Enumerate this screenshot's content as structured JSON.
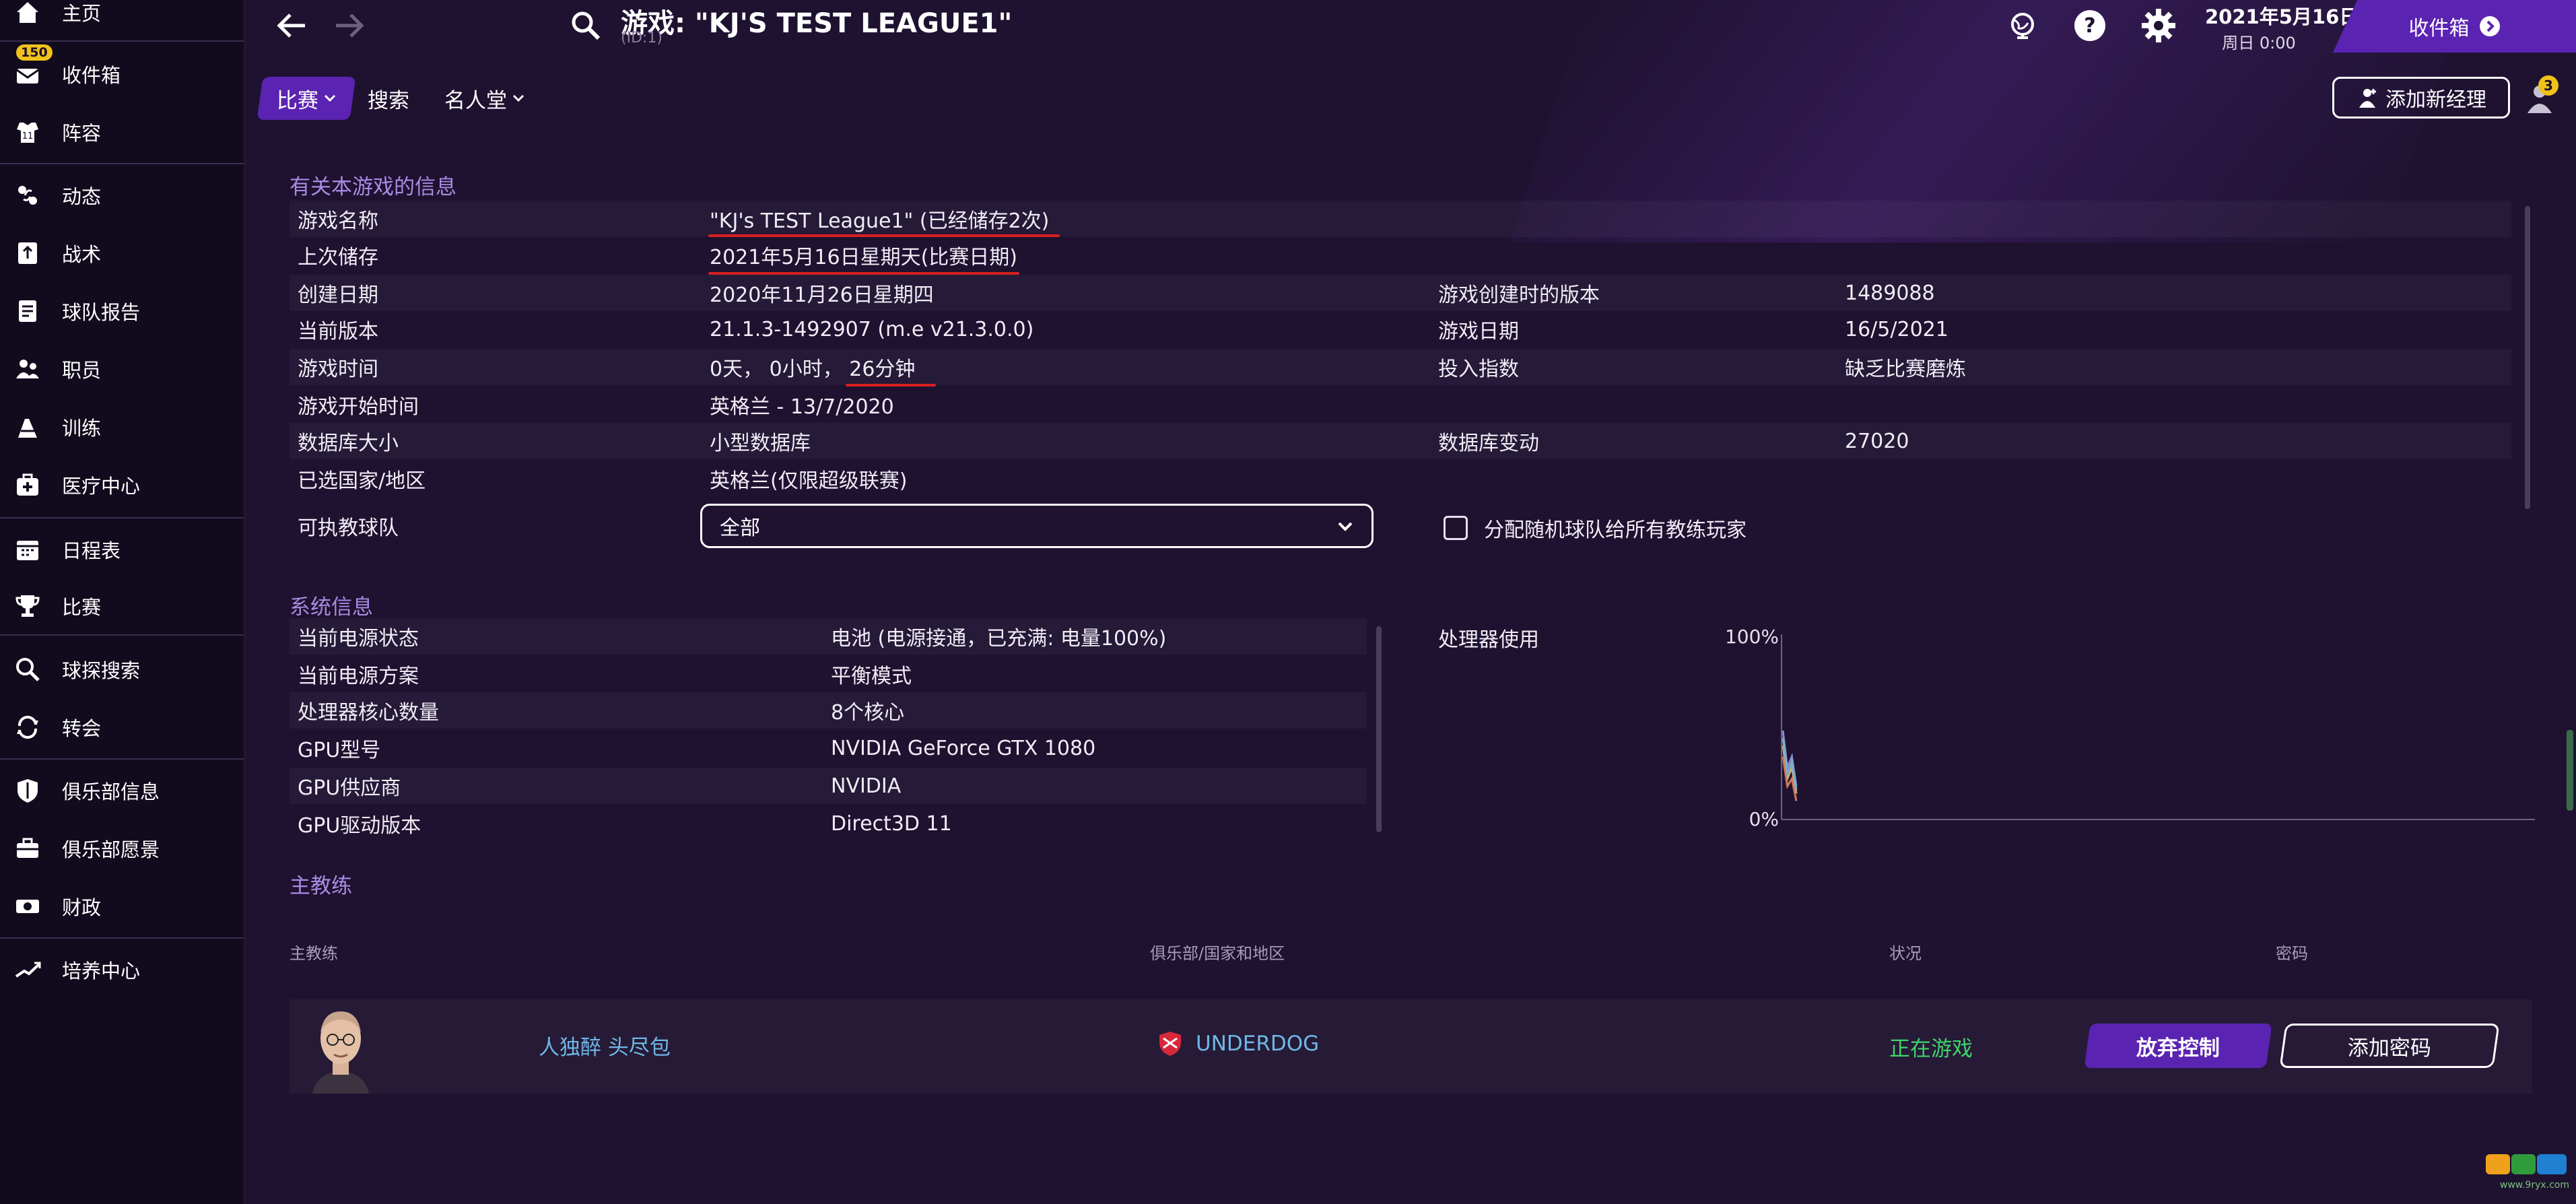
{
  "sidebar": {
    "items": [
      {
        "label": "主页",
        "icon": "home-icon"
      },
      {
        "label": "收件箱",
        "icon": "inbox-icon",
        "badge": "150"
      },
      {
        "label": "阵容",
        "icon": "squad-icon"
      },
      {
        "label": "动态",
        "icon": "dynamics-icon"
      },
      {
        "label": "战术",
        "icon": "tactics-icon"
      },
      {
        "label": "球队报告",
        "icon": "report-icon"
      },
      {
        "label": "职员",
        "icon": "staff-icon"
      },
      {
        "label": "训练",
        "icon": "training-icon"
      },
      {
        "label": "医疗中心",
        "icon": "medical-icon"
      },
      {
        "label": "日程表",
        "icon": "calendar-icon"
      },
      {
        "label": "比赛",
        "icon": "trophy-icon"
      },
      {
        "label": "球探搜索",
        "icon": "scout-search-icon"
      },
      {
        "label": "转会",
        "icon": "transfers-icon"
      },
      {
        "label": "俱乐部信息",
        "icon": "shield-icon"
      },
      {
        "label": "俱乐部愿景",
        "icon": "briefcase-icon"
      },
      {
        "label": "财政",
        "icon": "finance-icon"
      },
      {
        "label": "培养中心",
        "icon": "development-icon"
      }
    ]
  },
  "header": {
    "title": "游戏: \"KJ'S TEST LEAGUE1\"",
    "subtitle": "(ID:1)",
    "date_main": "2021年5月16日",
    "date_sub": "周日 0:00",
    "continue_label": "收件箱"
  },
  "tabs": {
    "match": "比赛",
    "search": "搜索",
    "hall_of_fame": "名人堂",
    "add_manager": "添加新经理",
    "players_badge": "3"
  },
  "game_info": {
    "section_title": "有关本游戏的信息",
    "rows": [
      {
        "label": "游戏名称",
        "value": "\"KJ's TEST League1\" (已经储存2次)"
      },
      {
        "label": "上次储存",
        "value": "2021年5月16日星期天(比赛日期)"
      },
      {
        "label": "创建日期",
        "value": "2020年11月26日星期四",
        "label2": "游戏创建时的版本",
        "value2": "1489088"
      },
      {
        "label": "当前版本",
        "value": "21.1.3-1492907 (m.e v21.3.0.0)",
        "label2": "游戏日期",
        "value2": "16/5/2021"
      },
      {
        "label": "游戏时间",
        "value": "0天， 0小时， 26分钟",
        "label2": "投入指数",
        "value2": "缺乏比赛磨炼"
      },
      {
        "label": "游戏开始时间",
        "value": "英格兰 - 13/7/2020"
      },
      {
        "label": "数据库大小",
        "value": "小型数据库",
        "label2": "数据库变动",
        "value2": "27020"
      },
      {
        "label": "已选国家/地区",
        "value": "英格兰(仅限超级联赛)"
      }
    ],
    "coach_team_label": "可执教球队",
    "coach_team_value": "全部",
    "assign_random_label": "分配随机球队给所有教练玩家"
  },
  "system_info": {
    "section_title": "系统信息",
    "rows": [
      {
        "label": "当前电源状态",
        "value": "电池 (电源接通，已充满: 电量100%)"
      },
      {
        "label": "当前电源方案",
        "value": "平衡模式"
      },
      {
        "label": "处理器核心数量",
        "value": "8个核心"
      },
      {
        "label": "GPU型号",
        "value": "NVIDIA GeForce GTX 1080"
      },
      {
        "label": "GPU供应商",
        "value": "NVIDIA"
      },
      {
        "label": "GPU驱动版本",
        "value": "Direct3D 11"
      }
    ],
    "cpu_label": "处理器使用"
  },
  "chart_data": {
    "type": "line",
    "ylim": [
      0,
      100
    ],
    "ytick_labels": [
      "100%",
      "0%"
    ],
    "x": [
      0,
      1,
      2,
      3
    ],
    "series": [
      {
        "color": "#8a8fd6",
        "values": [
          48,
          28,
          34,
          18
        ]
      },
      {
        "color": "#c9b07a",
        "values": [
          40,
          22,
          28,
          14
        ]
      },
      {
        "color": "#d07a5a",
        "values": [
          34,
          18,
          22,
          10
        ]
      },
      {
        "color": "#7ab0c9",
        "values": [
          44,
          25,
          31,
          16
        ]
      }
    ]
  },
  "manager": {
    "section_title": "主教练",
    "headers": {
      "manager": "主教练",
      "club": "俱乐部/国家和地区",
      "status": "状况",
      "password": "密码"
    },
    "name": "人独醉 头尽包",
    "club": "UNDERDOG",
    "status": "正在游戏",
    "release_label": "放弃控制",
    "add_password_label": "添加密码"
  },
  "colors": {
    "accent": "#5b23b2",
    "section_title": "#a98be3",
    "link": "#6fb8e6",
    "status_ok": "#3fd46a",
    "badge": "#f2c21b",
    "annotation_red": "#d62020"
  }
}
